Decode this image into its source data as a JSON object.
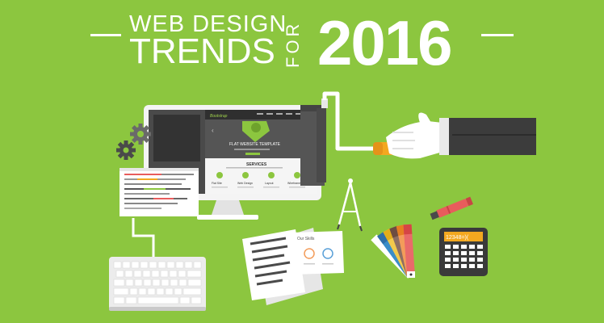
{
  "banner": {
    "line1": "WEB DESIGN",
    "line2": "TRENDS",
    "for_word": "FOR",
    "year": "2016",
    "background_color": "#8cc63f"
  },
  "website_mockup": {
    "hero_heading": "FLAT WEBSITE TEMPLATE",
    "section_title": "SERVICES",
    "service_cards": [
      "Flat Site",
      "Web Design",
      "Layout",
      "Wireframes"
    ]
  },
  "document": {
    "heading": "Our Skills"
  },
  "calculator": {
    "display": "12348=)("
  },
  "icons": [
    "gear-icon",
    "paint-roller-icon",
    "compass-icon",
    "highlighter-icon",
    "color-swatch-icon",
    "calculator-icon",
    "keyboard-icon"
  ]
}
